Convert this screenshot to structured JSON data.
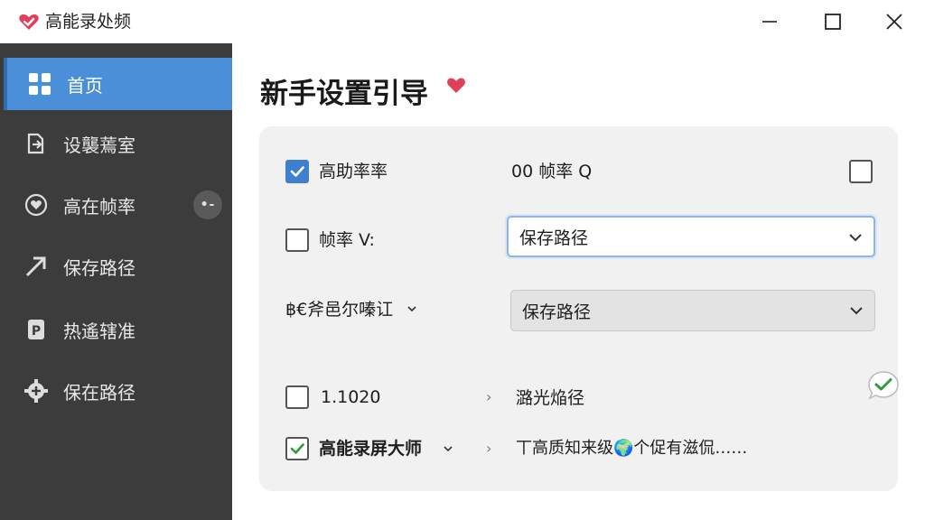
{
  "window": {
    "title": "高能录处频",
    "icons": {
      "logo": "heart-check-logo",
      "minimize": "minimize-icon",
      "maximize": "maximize-icon",
      "close": "close-icon"
    }
  },
  "sidebar": {
    "items": [
      {
        "label": "首页",
        "icon": "grid-icon",
        "active": true
      },
      {
        "label": "设襲蔫室",
        "icon": "document-export-icon",
        "active": false
      },
      {
        "label": "高在帧率",
        "icon": "record-circle-icon",
        "active": false,
        "badge": "•-"
      },
      {
        "label": "保存路径",
        "icon": "arrow-up-right-icon",
        "active": false
      },
      {
        "label": "热遙辖准",
        "icon": "parking-doc-icon",
        "active": false
      },
      {
        "label": "保在路径",
        "icon": "gear-plus-icon",
        "active": false
      }
    ]
  },
  "main": {
    "title": "新⼿设置引导",
    "settings": {
      "row1": {
        "label": "高助率率",
        "checked": true,
        "right_label": "00 帧率 Q",
        "right_checked": false
      },
      "row2": {
        "label": "帧率 V:",
        "checked": false,
        "select_value": "保存路径"
      },
      "row3": {
        "label": "฿€斧邑尔嗪讧",
        "select_value": "保存路径"
      },
      "row4": {
        "label": "1.1020",
        "right_label": "潞光焔径",
        "checked": false
      },
      "row5": {
        "label": "高能录屏大师",
        "right_label": "丅高质知来级🌍个促有滋侃……",
        "checked": true
      }
    },
    "colors": {
      "accent": "#4a8fd8",
      "sidebar_bg": "#3c3c3c",
      "check_green": "#2e9a3a",
      "heart": "#e0405a"
    }
  }
}
